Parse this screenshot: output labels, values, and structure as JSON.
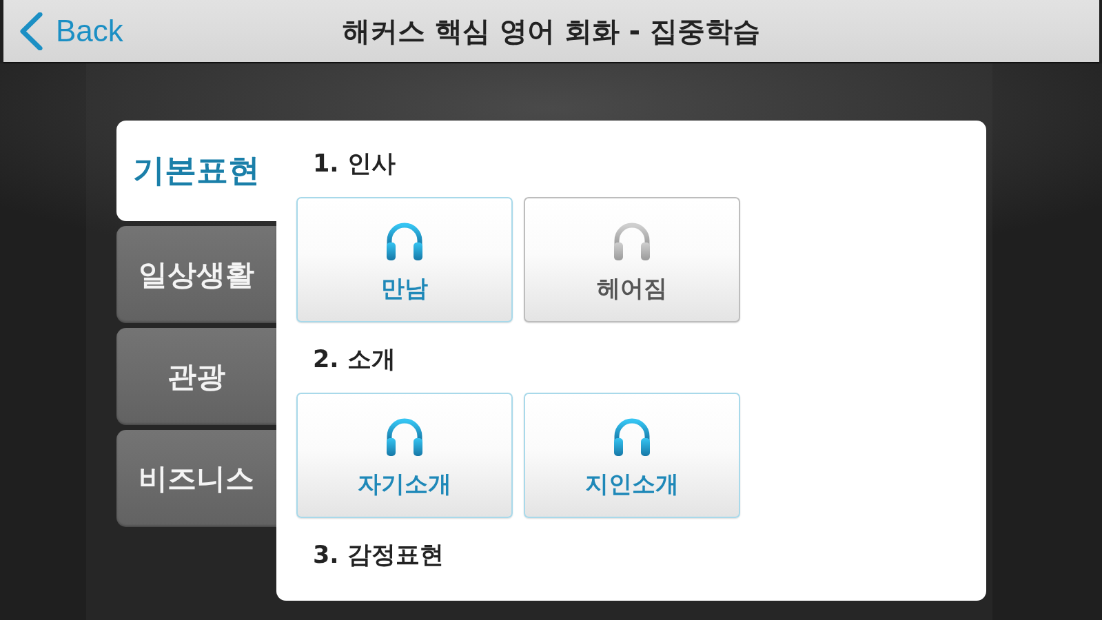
{
  "header": {
    "back_label": "Back",
    "title": "해커스 핵심 영어 회화 - 집중학습"
  },
  "tabs": [
    {
      "label": "기본표현",
      "selected": true
    },
    {
      "label": "일상생활",
      "selected": false
    },
    {
      "label": "관광",
      "selected": false
    },
    {
      "label": "비즈니스",
      "selected": false
    }
  ],
  "sections": [
    {
      "heading": "1. 인사",
      "lessons": [
        {
          "label": "만남",
          "disabled": false
        },
        {
          "label": "헤어짐",
          "disabled": true
        }
      ]
    },
    {
      "heading": "2. 소개",
      "lessons": [
        {
          "label": "자기소개",
          "disabled": false
        },
        {
          "label": "지인소개",
          "disabled": false
        }
      ]
    },
    {
      "heading": "3. 감정표현"
    }
  ]
}
